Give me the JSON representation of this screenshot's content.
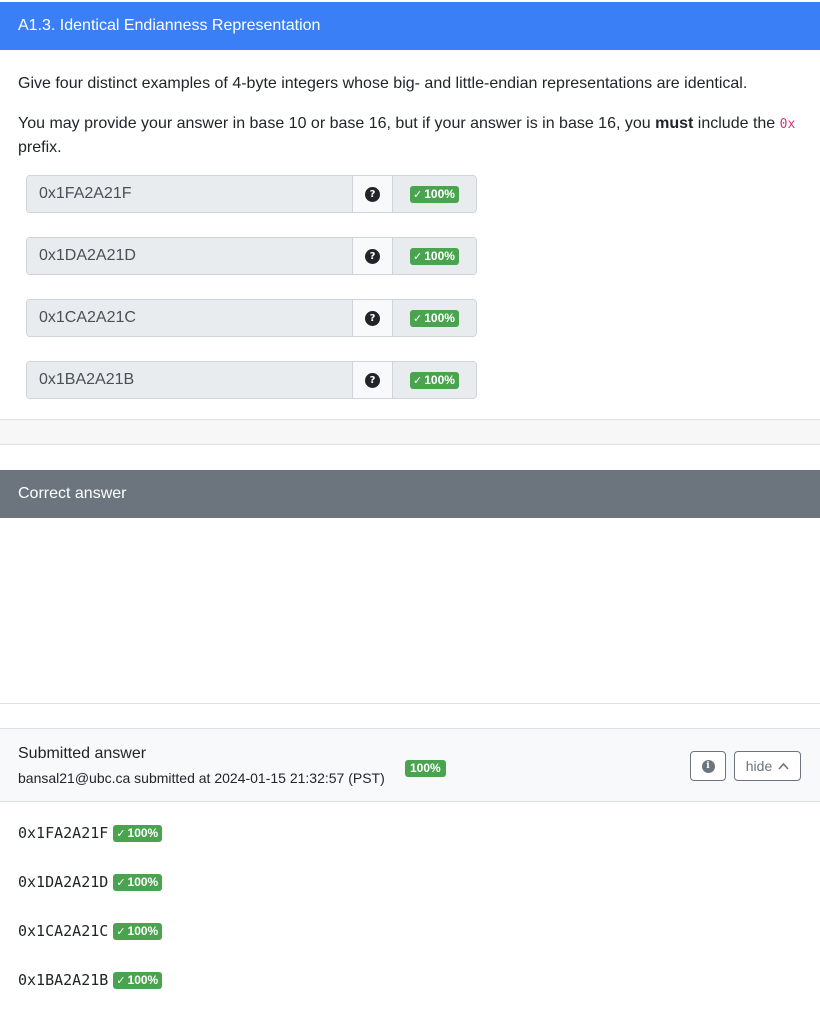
{
  "question": {
    "title": "A1.3. Identical Endianness Representation",
    "prompt": "Give four distinct examples of 4-byte integers whose big- and little-endian representations are identical.",
    "instructions_before": "You may provide your answer in base 10 or base 16, but if your answer is in base 16, you ",
    "instructions_bold": "must",
    "instructions_mid": " include the ",
    "instructions_code": "0x",
    "instructions_after": " prefix."
  },
  "answers": [
    {
      "value": "0x1FA2A21F",
      "help": "?",
      "score": "100%"
    },
    {
      "value": "0x1DA2A21D",
      "help": "?",
      "score": "100%"
    },
    {
      "value": "0x1CA2A21C",
      "help": "?",
      "score": "100%"
    },
    {
      "value": "0x1BA2A21B",
      "help": "?",
      "score": "100%"
    }
  ],
  "correct_answer": {
    "title": "Correct answer"
  },
  "submission": {
    "title": "Submitted answer",
    "meta": "bansal21@ubc.ca submitted at 2024-01-15 21:32:57 (PST)",
    "score": "100%",
    "hide_label": "hide",
    "items": [
      {
        "value": "0x1FA2A21F",
        "score": "100%"
      },
      {
        "value": "0x1DA2A21D",
        "score": "100%"
      },
      {
        "value": "0x1CA2A21C",
        "score": "100%"
      },
      {
        "value": "0x1BA2A21B",
        "score": "100%"
      }
    ]
  },
  "colors": {
    "question_header": "#3a7ff5",
    "correct_header": "#6c757d",
    "success_badge": "#4aa34f"
  },
  "icons": [
    "check-icon",
    "question-circle-icon",
    "info-circle-icon",
    "chevron-up-icon"
  ]
}
